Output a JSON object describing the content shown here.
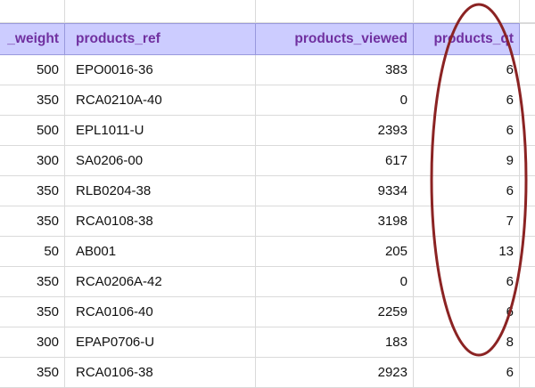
{
  "headers": {
    "col1": "_weight",
    "col2": "products_ref",
    "col3": "products_viewed",
    "col4": "products_qt"
  },
  "rows": [
    {
      "weight": "500",
      "ref": "EPO0016-36",
      "viewed": "383",
      "qt": "6"
    },
    {
      "weight": "350",
      "ref": "RCA0210A-40",
      "viewed": "0",
      "qt": "6"
    },
    {
      "weight": "500",
      "ref": "EPL1011-U",
      "viewed": "2393",
      "qt": "6"
    },
    {
      "weight": "300",
      "ref": "SA0206-00",
      "viewed": "617",
      "qt": "9"
    },
    {
      "weight": "350",
      "ref": "RLB0204-38",
      "viewed": "9334",
      "qt": "6"
    },
    {
      "weight": "350",
      "ref": "RCA0108-38",
      "viewed": "3198",
      "qt": "7"
    },
    {
      "weight": "50",
      "ref": "AB001",
      "viewed": "205",
      "qt": "13"
    },
    {
      "weight": "350",
      "ref": "RCA0206A-42",
      "viewed": "0",
      "qt": "6"
    },
    {
      "weight": "350",
      "ref": "RCA0106-40",
      "viewed": "2259",
      "qt": "6"
    },
    {
      "weight": "300",
      "ref": "EPAP0706-U",
      "viewed": "183",
      "qt": "8"
    },
    {
      "weight": "350",
      "ref": "RCA0106-38",
      "viewed": "2923",
      "qt": "6"
    }
  ],
  "colors": {
    "header_bg": "#ccccff",
    "header_text": "#7030a0",
    "annotation_ellipse": "#8b2323"
  }
}
